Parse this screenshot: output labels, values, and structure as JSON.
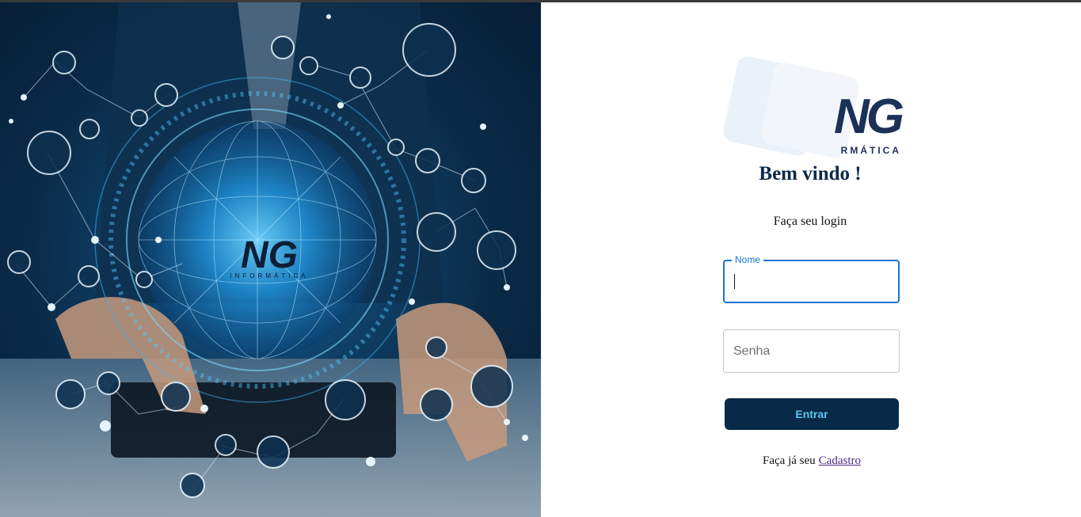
{
  "hero": {
    "logo_text": "NG",
    "logo_subtext": "INFORMÁTICA"
  },
  "brand": {
    "logo_text": "NG",
    "logo_subtext": "RMÁTICA",
    "color": "#1c3158"
  },
  "login": {
    "welcome": "Bem vindo !",
    "subtitle": "Faça seu login",
    "name_label": "Nome",
    "name_value": "",
    "password_placeholder": "Senha",
    "submit_label": "Entrar",
    "signup_prompt": "Faça já seu",
    "signup_link": "Cadastro"
  },
  "colors": {
    "accent": "#1976d2",
    "button_bg": "#062a47",
    "button_text": "#5cc6f0",
    "heading": "#0c2a4a"
  }
}
